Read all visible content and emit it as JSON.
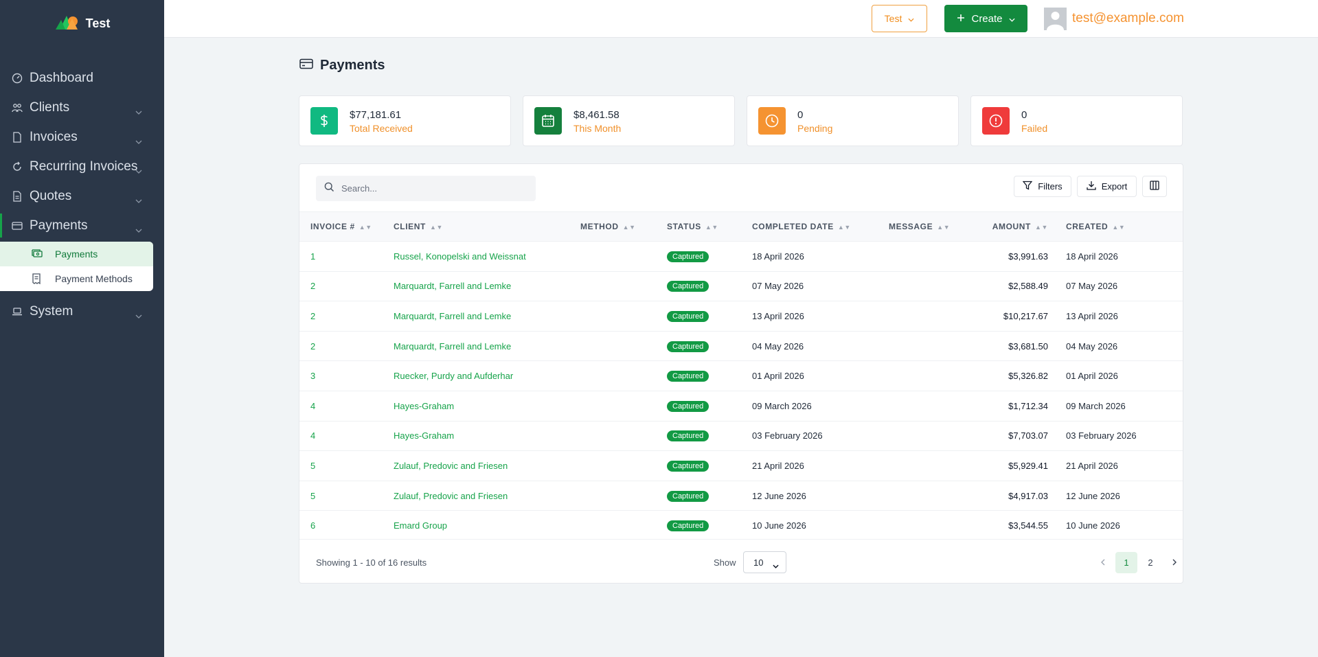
{
  "app": {
    "name": "Test"
  },
  "sidebar": {
    "items": [
      {
        "label": "Dashboard",
        "icon": "dashboard-icon"
      },
      {
        "label": "Clients",
        "icon": "users-icon"
      },
      {
        "label": "Invoices",
        "icon": "file-icon"
      },
      {
        "label": "Recurring Invoices",
        "icon": "refresh-icon"
      },
      {
        "label": "Quotes",
        "icon": "file-text-icon"
      },
      {
        "label": "Payments",
        "icon": "credit-card-icon"
      },
      {
        "label": "System",
        "icon": "laptop-icon"
      }
    ],
    "payments_sub": [
      {
        "label": "Payments",
        "icon": "cash-icon"
      },
      {
        "label": "Payment Methods",
        "icon": "receipt-icon"
      }
    ]
  },
  "header": {
    "company_label": "Test",
    "create_label": "Create",
    "user_email": "test@example.com"
  },
  "page": {
    "title": "Payments"
  },
  "stats": [
    {
      "value": "$77,181.61",
      "label": "Total Received",
      "color": "#10b981"
    },
    {
      "value": "$8,461.58",
      "label": "This Month",
      "color": "#15803d"
    },
    {
      "value": "0",
      "label": "Pending",
      "color": "#f59331"
    },
    {
      "value": "0",
      "label": "Failed",
      "color": "#ef3b3b"
    }
  ],
  "toolbar": {
    "search_placeholder": "Search...",
    "filters_label": "Filters",
    "export_label": "Export"
  },
  "table": {
    "columns": [
      "INVOICE #",
      "CLIENT",
      "METHOD",
      "STATUS",
      "COMPLETED DATE",
      "MESSAGE",
      "AMOUNT",
      "CREATED"
    ],
    "rows": [
      {
        "invoice": "1",
        "client": "Russel, Konopelski and Weissnat",
        "method": "",
        "status": "Captured",
        "completed": "18 April 2026",
        "message": "",
        "amount": "$3,991.63",
        "created": "18 April 2026"
      },
      {
        "invoice": "2",
        "client": "Marquardt, Farrell and Lemke",
        "method": "",
        "status": "Captured",
        "completed": "07 May 2026",
        "message": "",
        "amount": "$2,588.49",
        "created": "07 May 2026"
      },
      {
        "invoice": "2",
        "client": "Marquardt, Farrell and Lemke",
        "method": "",
        "status": "Captured",
        "completed": "13 April 2026",
        "message": "",
        "amount": "$10,217.67",
        "created": "13 April 2026"
      },
      {
        "invoice": "2",
        "client": "Marquardt, Farrell and Lemke",
        "method": "",
        "status": "Captured",
        "completed": "04 May 2026",
        "message": "",
        "amount": "$3,681.50",
        "created": "04 May 2026"
      },
      {
        "invoice": "3",
        "client": "Ruecker, Purdy and Aufderhar",
        "method": "",
        "status": "Captured",
        "completed": "01 April 2026",
        "message": "",
        "amount": "$5,326.82",
        "created": "01 April 2026"
      },
      {
        "invoice": "4",
        "client": "Hayes-Graham",
        "method": "",
        "status": "Captured",
        "completed": "09 March 2026",
        "message": "",
        "amount": "$1,712.34",
        "created": "09 March 2026"
      },
      {
        "invoice": "4",
        "client": "Hayes-Graham",
        "method": "",
        "status": "Captured",
        "completed": "03 February 2026",
        "message": "",
        "amount": "$7,703.07",
        "created": "03 February 2026"
      },
      {
        "invoice": "5",
        "client": "Zulauf, Predovic and Friesen",
        "method": "",
        "status": "Captured",
        "completed": "21 April 2026",
        "message": "",
        "amount": "$5,929.41",
        "created": "21 April 2026"
      },
      {
        "invoice": "5",
        "client": "Zulauf, Predovic and Friesen",
        "method": "",
        "status": "Captured",
        "completed": "12 June 2026",
        "message": "",
        "amount": "$4,917.03",
        "created": "12 June 2026"
      },
      {
        "invoice": "6",
        "client": "Emard Group",
        "method": "",
        "status": "Captured",
        "completed": "10 June 2026",
        "message": "",
        "amount": "$3,544.55",
        "created": "10 June 2026"
      }
    ]
  },
  "pagination": {
    "summary": "Showing 1 - 10 of 16 results",
    "show_label": "Show",
    "page_size": "10",
    "pages": [
      "1",
      "2"
    ],
    "current_page": "1"
  }
}
